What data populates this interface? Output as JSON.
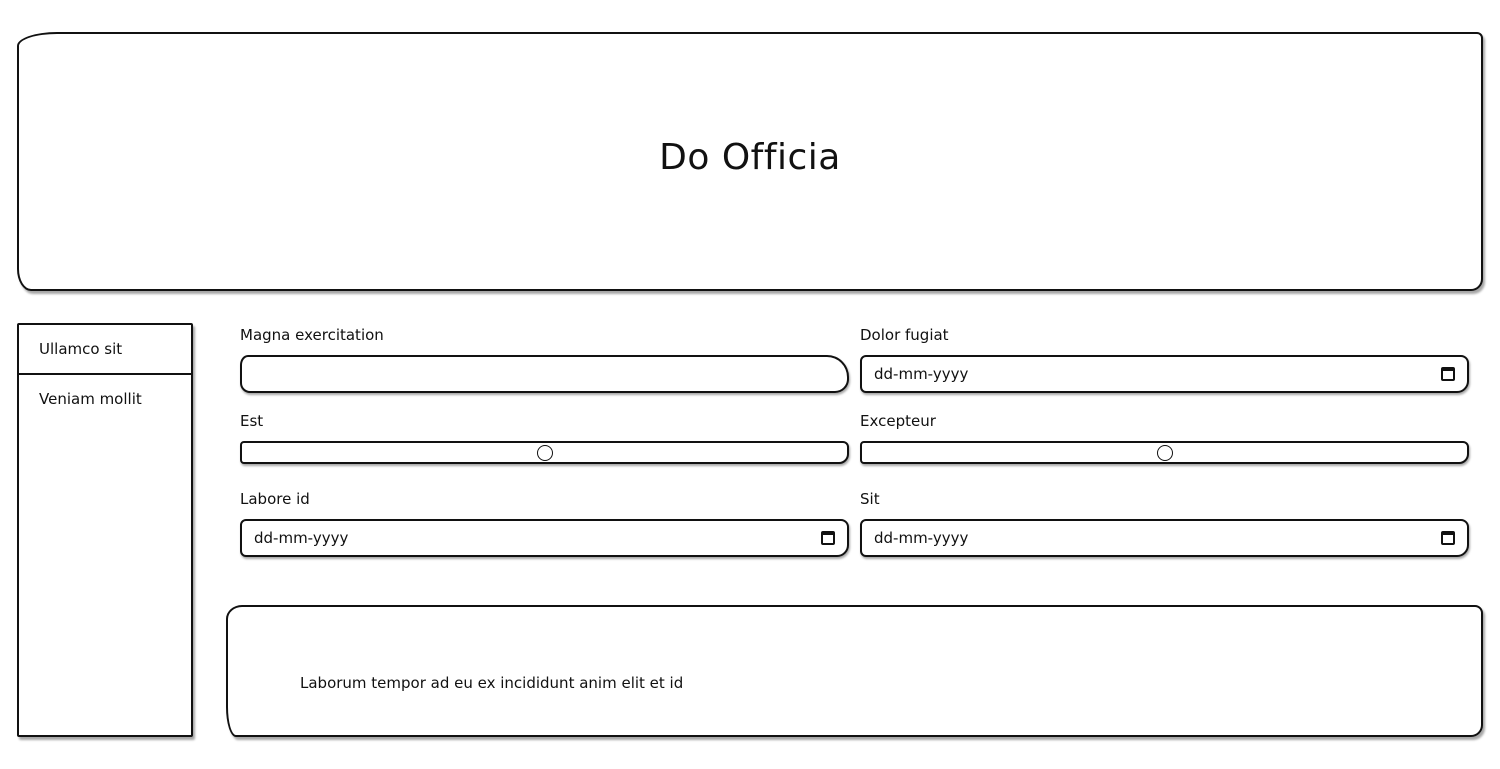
{
  "header": {
    "title": "Do Officia"
  },
  "sidebar": {
    "items": [
      {
        "label": "Ullamco sit"
      },
      {
        "label": "Veniam mollit"
      }
    ]
  },
  "form": {
    "magna": {
      "label": "Magna exercitation",
      "value": ""
    },
    "dolor": {
      "label": "Dolor fugiat",
      "placeholder": "dd-mm-yyyy"
    },
    "est": {
      "label": "Est",
      "value_fraction": 0.5
    },
    "excepteur": {
      "label": "Excepteur",
      "value_fraction": 0.5
    },
    "labore": {
      "label": "Labore id",
      "placeholder": "dd-mm-yyyy"
    },
    "sit": {
      "label": "Sit",
      "placeholder": "dd-mm-yyyy"
    }
  },
  "footer": {
    "text": "Laborum tempor ad eu ex incididunt anim elit et id"
  },
  "icons": {
    "date_picker": "calendar-icon"
  }
}
